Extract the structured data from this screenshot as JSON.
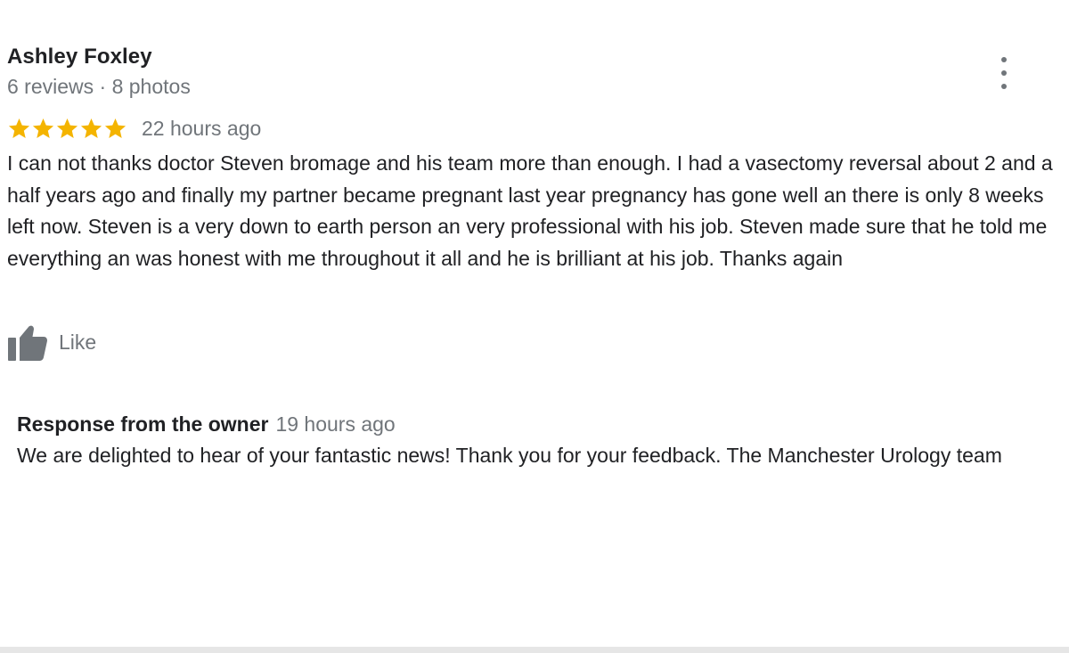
{
  "reviewer": {
    "name": "Ashley Foxley",
    "meta": "6 reviews · 8 photos"
  },
  "review": {
    "rating": 5,
    "rating_max": 5,
    "star_color": "#f4b400",
    "date": "22 hours ago",
    "text": "I can not thanks doctor Steven bromage and his team more than enough.  I had a vasectomy reversal about 2 and a half years ago and finally my partner became pregnant last year pregnancy has gone well an there is only 8 weeks left now. Steven is a very down to earth person an very professional with his job. Steven made sure that he told me everything an was honest with me throughout it all and he is brilliant at his job. Thanks again"
  },
  "actions": {
    "like_label": "Like",
    "like_icon": "thumb-up-icon",
    "more_icon": "more-vert-icon"
  },
  "owner_response": {
    "title": "Response from the owner",
    "date": "19 hours ago",
    "text": "We are delighted to hear of your fantastic news! Thank you for your feedback. The Manchester Urology team"
  }
}
